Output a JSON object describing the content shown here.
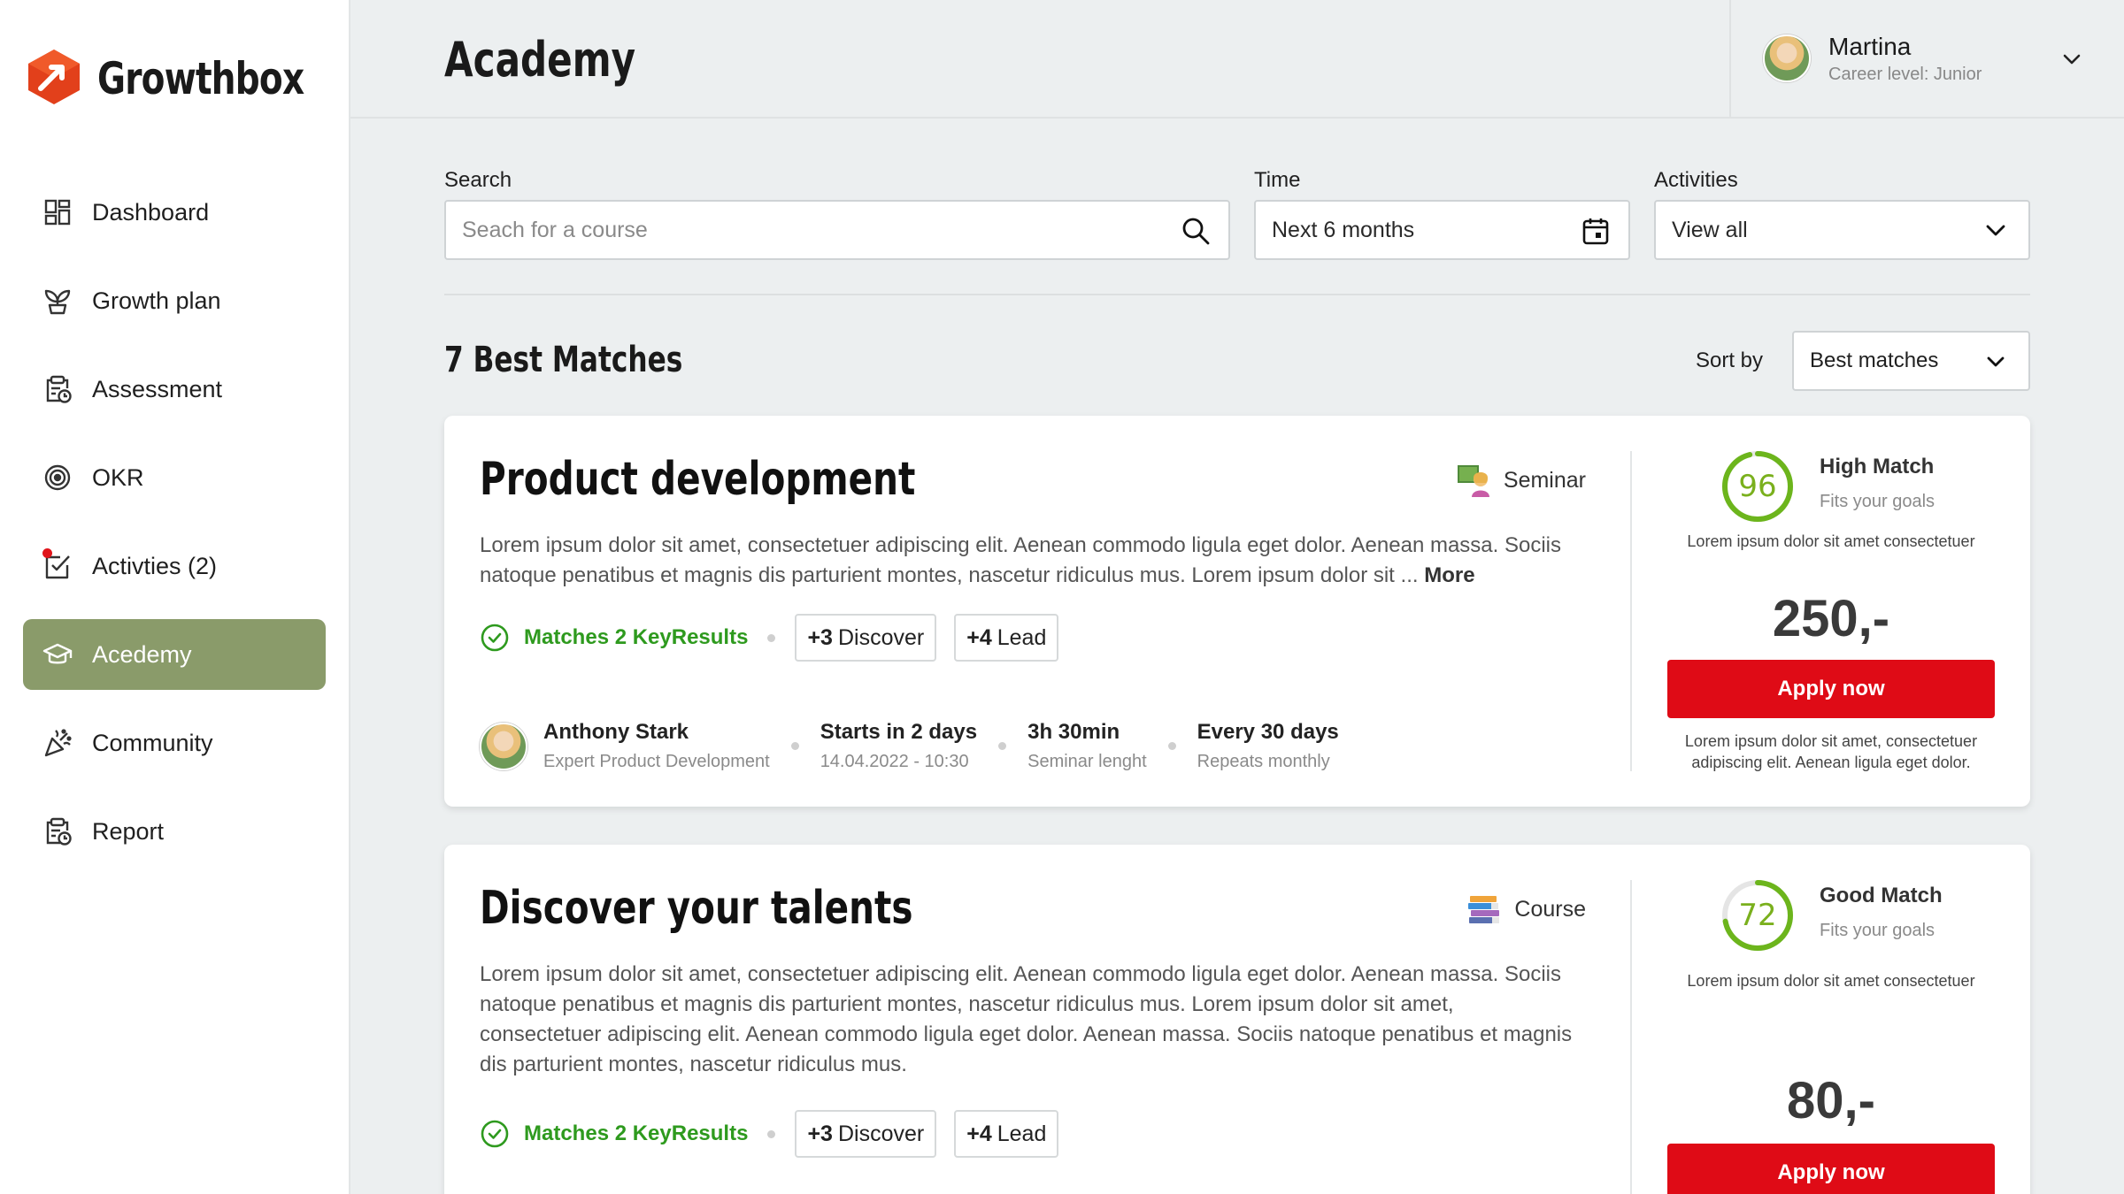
{
  "app": {
    "name": "Growthbox"
  },
  "sidebar": {
    "items": [
      {
        "label": "Dashboard",
        "icon": "dashboard-icon",
        "active": false
      },
      {
        "label": "Growth plan",
        "icon": "sprout-icon",
        "active": false
      },
      {
        "label": "Assessment",
        "icon": "clipboard-clock-icon",
        "active": false
      },
      {
        "label": "OKR",
        "icon": "target-icon",
        "active": false
      },
      {
        "label": "Activties (2)",
        "icon": "checklist-icon",
        "active": false,
        "notification": true
      },
      {
        "label": "Acedemy",
        "icon": "graduation-cap-icon",
        "active": true
      },
      {
        "label": "Community",
        "icon": "party-icon",
        "active": false
      },
      {
        "label": "Report",
        "icon": "report-icon",
        "active": false
      }
    ]
  },
  "header": {
    "title": "Academy",
    "user": {
      "name": "Martina",
      "level": "Career level: Junior"
    }
  },
  "filters": {
    "search": {
      "label": "Search",
      "placeholder": "Seach for a course"
    },
    "time": {
      "label": "Time",
      "value": "Next 6 months"
    },
    "activities": {
      "label": "Activities",
      "value": "View all"
    }
  },
  "results": {
    "title": "7 Best Matches",
    "sort_label": "Sort by",
    "sort_value": "Best matches"
  },
  "colors": {
    "accent": "#8a9b6a",
    "apply": "#df0b16",
    "match_green": "#2e9a1e",
    "score_green": "#7ab01d"
  },
  "cards": [
    {
      "title": "Product development",
      "type": "Seminar",
      "type_icon": "presenter-icon",
      "description": "Lorem ipsum dolor sit amet, consectetuer adipiscing elit. Aenean commodo ligula eget dolor. Aenean massa. Sociis natoque penatibus et magnis dis parturient montes, nascetur ridiculus mus. Lorem ipsum dolor sit ... ",
      "more": "More",
      "keyresults": "Matches 2 KeyResults",
      "chips": [
        {
          "count": "+3",
          "label": "Discover"
        },
        {
          "count": "+4",
          "label": "Lead"
        }
      ],
      "trainer": {
        "name": "Anthony Stark",
        "role": "Expert Product Development"
      },
      "start": {
        "title": "Starts in 2 days",
        "sub": "14.04.2022 - 10:30"
      },
      "length": {
        "title": "3h 30min",
        "sub": "Seminar lenght"
      },
      "repeat": {
        "title": "Every 30 days",
        "sub": "Repeats monthly"
      },
      "score": 96,
      "match_label": "High Match",
      "match_sub": "Fits your goals",
      "side_note": "Lorem ipsum dolor sit amet consectetuer",
      "price": "250,-",
      "apply": "Apply now",
      "footnote_1": "Lorem ipsum dolor sit amet, consectetuer",
      "footnote_2": "adipiscing elit. Aenean ligula eget dolor."
    },
    {
      "title": "Discover your talents",
      "type": "Course",
      "type_icon": "books-icon",
      "description": "Lorem ipsum dolor sit amet, consectetuer adipiscing elit. Aenean commodo ligula eget dolor. Aenean massa. Sociis natoque penatibus et magnis dis parturient montes, nascetur ridiculus mus. Lorem ipsum dolor sit amet, consectetuer adipiscing elit. Aenean commodo ligula eget dolor. Aenean massa. Sociis natoque penatibus et magnis dis parturient montes, nascetur ridiculus mus.",
      "keyresults": "Matches 2 KeyResults",
      "chips": [
        {
          "count": "+3",
          "label": "Discover"
        },
        {
          "count": "+4",
          "label": "Lead"
        }
      ],
      "score": 72,
      "match_label": "Good Match",
      "match_sub": "Fits your goals",
      "side_note": "Lorem ipsum dolor sit amet consectetuer",
      "price": "80,-",
      "apply": "Apply now"
    }
  ]
}
